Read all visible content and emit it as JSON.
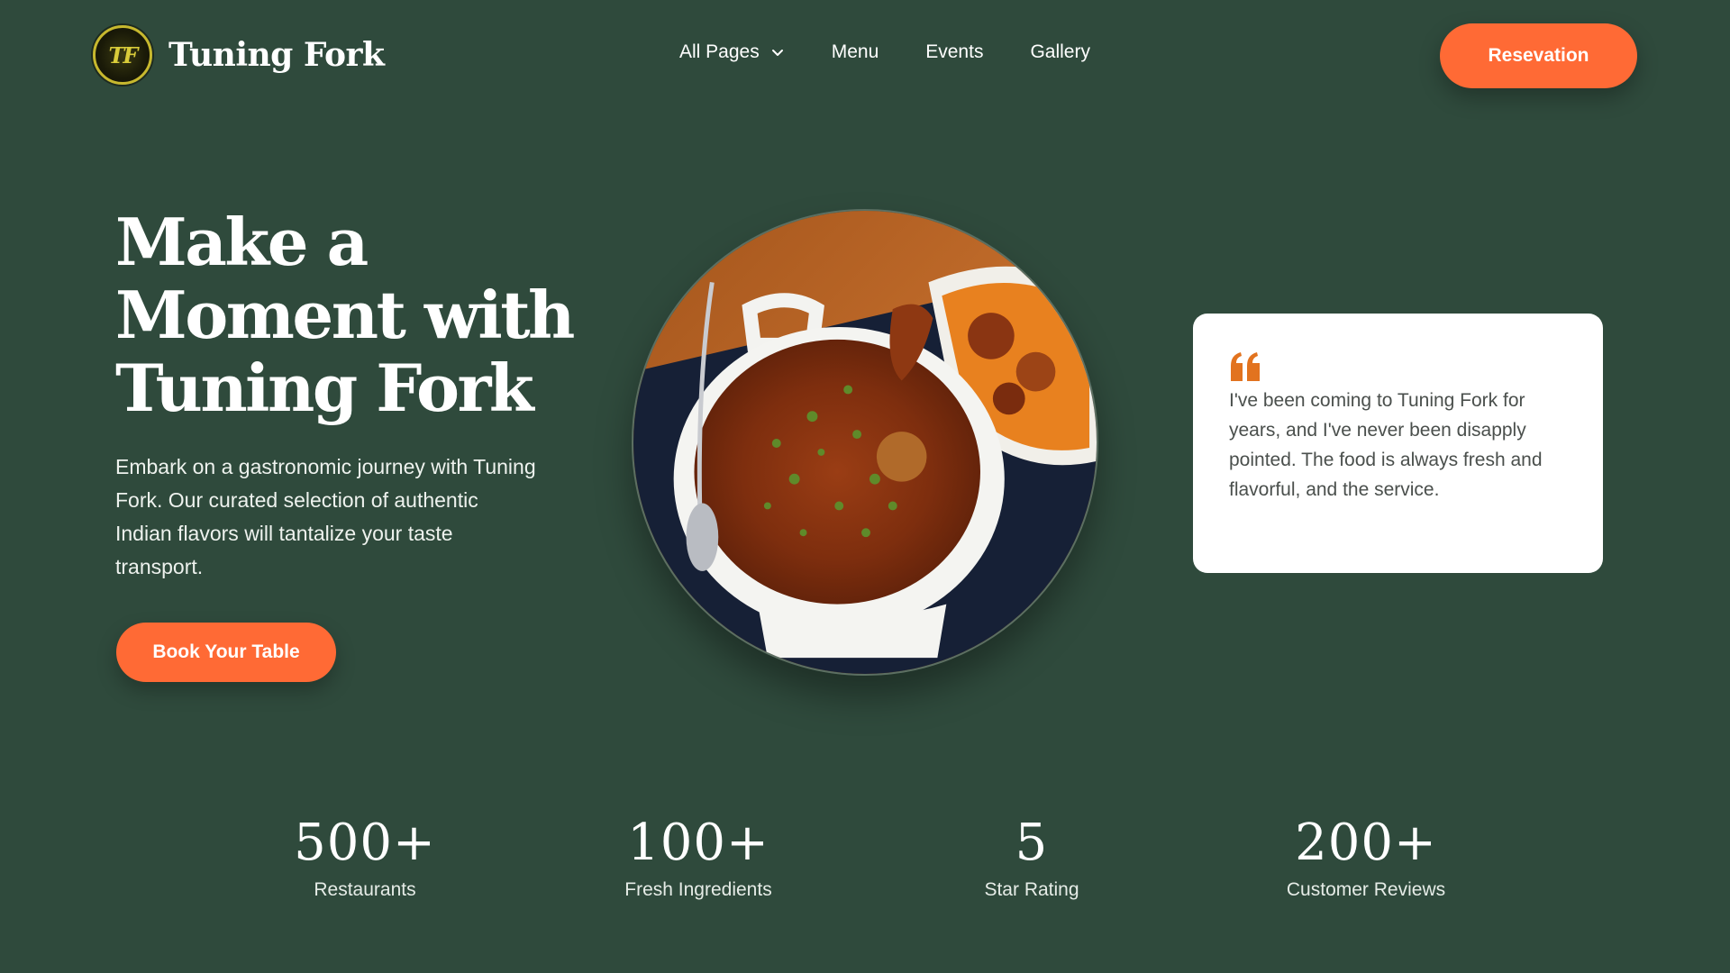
{
  "brand": {
    "name": "Tuning Fork",
    "logo_initials": "TF"
  },
  "nav": {
    "items": [
      {
        "label": "All Pages",
        "icon": "chevron-down-icon"
      },
      {
        "label": "Menu"
      },
      {
        "label": "Events"
      },
      {
        "label": "Gallery"
      }
    ],
    "reservation_label": "Resevation"
  },
  "hero": {
    "title_lines": [
      "Make a",
      "Moment with",
      "Tuning Fork"
    ],
    "description": "Embark on a gastronomic journey with Tuning Fork. Our curated selection of authentic Indian flavors will tantalize your taste transport.",
    "cta_label": "Book Your Table"
  },
  "testimonial": {
    "icon": "quote-icon",
    "text": "I've been coming to Tuning Fork for years, and I've never been disapply pointed. The food is always fresh and flavorful, and the service."
  },
  "stats": [
    {
      "value": "500+",
      "label": "Restaurants"
    },
    {
      "value": "100+",
      "label": "Fresh Ingredients"
    },
    {
      "value": "5",
      "label": "Star Rating"
    },
    {
      "value": "200+",
      "label": "Customer Reviews"
    }
  ],
  "colors": {
    "background": "#2f4a3c",
    "accent": "#ff6a35",
    "quote": "#e2731f",
    "card": "#ffffff"
  }
}
